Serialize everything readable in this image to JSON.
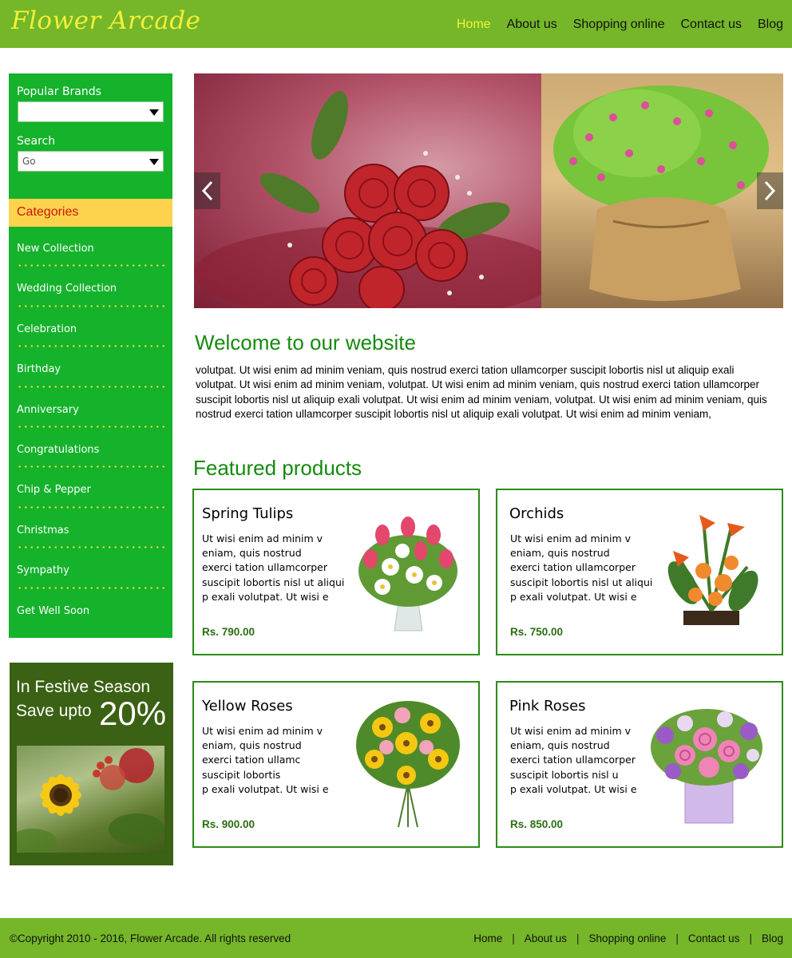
{
  "header": {
    "logo": "Flower Arcade",
    "nav": [
      {
        "label": "Home",
        "active": true
      },
      {
        "label": "About us"
      },
      {
        "label": "Shopping online"
      },
      {
        "label": "Contact us"
      },
      {
        "label": "Blog"
      }
    ]
  },
  "sidebar": {
    "brands_label": "Popular Brands",
    "brands_value": "",
    "search_label": "Search",
    "search_value": "Go",
    "categories_title": "Categories",
    "categories": [
      "New Collection",
      "Wedding Collection",
      "Celebration",
      "Birthday",
      "Anniversary",
      "Congratulations",
      "Chip & Pepper",
      "Christmas",
      "Sympathy",
      "Get Well Soon"
    ]
  },
  "promo": {
    "line1": "In Festive Season",
    "line2": "Save upto",
    "percent": "20%"
  },
  "welcome": {
    "title": "Welcome to our website",
    "text": "volutpat. Ut wisi enim ad minim veniam, quis nostrud exerci tation ullamcorper suscipit lobortis nisl ut aliquip exali volutpat. Ut wisi enim ad minim veniam,  volutpat. Ut wisi enim ad minim veniam, quis nostrud exerci tation ullamcorper suscipit lobortis nisl ut aliquip exali volutpat. Ut wisi enim ad minim veniam, volutpat. Ut wisi enim ad minim veniam, quis nostrud exerci tation ullamcorper suscipit lobortis nisl ut aliquip exali volutpat. Ut wisi enim ad minim veniam,"
  },
  "featured": {
    "title": "Featured products",
    "products": [
      {
        "name": "Spring Tulips",
        "desc": "Ut wisi enim ad minim v\neniam, quis nostrud\nexerci tation ullamcorper\nsuscipit lobortis nisl ut aliqui\np exali volutpat. Ut wisi e",
        "price": "Rs. 790.00",
        "icon": "tulip-bouquet-image"
      },
      {
        "name": "Orchids",
        "desc": "Ut wisi enim ad minim v\neniam, quis nostrud\nexerci tation ullamcorper\nsuscipit lobortis nisl ut aliqui\np exali volutpat. Ut wisi e",
        "price": "Rs. 750.00",
        "icon": "orchid-arrangement-image"
      },
      {
        "name": "Yellow Roses",
        "desc": "Ut wisi enim ad minim v\neniam, quis nostrud\nexerci tation ullamc\nsuscipit lobortis\np exali volutpat. Ut wisi e",
        "price": "Rs. 900.00",
        "icon": "yellow-rose-bouquet-image"
      },
      {
        "name": "Pink Roses",
        "desc": "Ut wisi enim ad minim v\neniam, quis nostrud\nexerci tation ullamcorper\nsuscipit lobortis nisl u\np exali volutpat. Ut wisi e",
        "price": "Rs. 850.00",
        "icon": "pink-rose-vase-image"
      }
    ]
  },
  "footer": {
    "copyright": "©Copyright 2010 - 2016, Flower Arcade. All rights reserved",
    "links": [
      "Home",
      "About us",
      "Shopping online",
      "Contact us",
      "Blog"
    ],
    "separator": "|"
  },
  "colors": {
    "header_bg": "#75b728",
    "sidebar_bg": "#15b22c",
    "accent_yellow": "#f4f23a",
    "heading_green": "#168a0e",
    "category_header": "#fdd24d",
    "promo_bg": "#3b6114"
  }
}
